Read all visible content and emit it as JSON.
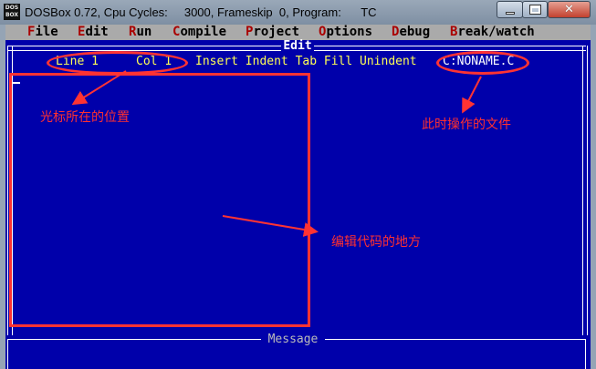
{
  "window": {
    "title": "DOSBox 0.72, Cpu Cycles:     3000, Frameskip  0, Program:      TC",
    "icon_text": "DOS BOX"
  },
  "menu": [
    {
      "hot": "F",
      "rest": "ile"
    },
    {
      "hot": "E",
      "rest": "dit"
    },
    {
      "hot": "R",
      "rest": "un"
    },
    {
      "hot": "C",
      "rest": "ompile"
    },
    {
      "hot": "P",
      "rest": "roject"
    },
    {
      "hot": "O",
      "rest": "ptions"
    },
    {
      "hot": "D",
      "rest": "ebug"
    },
    {
      "hot": "B",
      "rest": "reak/watch"
    }
  ],
  "editor": {
    "title": "Edit",
    "line": "Line 1",
    "col": "Col 1",
    "modes": "Insert Indent Tab Fill Unindent",
    "filename": "C:NONAME.C"
  },
  "message": {
    "title": "Message"
  },
  "annotations": {
    "cursor_label": "光标所在的位置",
    "file_label": "此时操作的文件",
    "code_label": "编辑代码的地方",
    "color": "#ff3333"
  },
  "colors": {
    "dos_blue": "#0000aa",
    "menu_gray": "#aaaaaa",
    "hotkey_red": "#aa0000",
    "status_yellow": "#ffff55"
  }
}
